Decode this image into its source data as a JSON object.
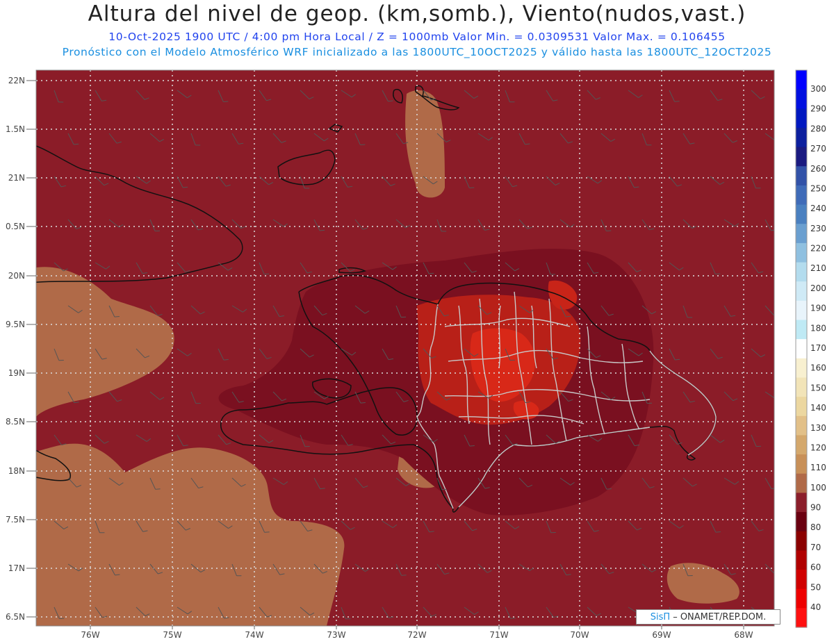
{
  "header": {
    "title": "Altura del nivel de geop. (km,somb.), Viento(nudos,vast.)",
    "line1": "10-Oct-2025  1900 UTC / 4:00 pm Hora Local / Z = 1000mb  Valor Min. = 0.0309531  Valor Max. = 0.106455",
    "line2": "Pronóstico con el Modelo Atmosférico WRF inicializado a las 1800UTC_10OCT2025 y válido hasta las  1800UTC_12OCT2025"
  },
  "axes": {
    "lat_labels": [
      "22N",
      "1.5N",
      "21N",
      "0.5N",
      "20N",
      "9.5N",
      "19N",
      "8.5N",
      "18N",
      "7.5N",
      "17N",
      "6.5N"
    ],
    "lon_labels": [
      "76W",
      "75W",
      "74W",
      "73W",
      "72W",
      "71W",
      "70W",
      "69W",
      "68W"
    ]
  },
  "colorbar": {
    "labels": [
      "300",
      "290",
      "280",
      "270",
      "260",
      "250",
      "240",
      "230",
      "220",
      "210",
      "200",
      "190",
      "180",
      "170",
      "160",
      "150",
      "140",
      "130",
      "120",
      "110",
      "100",
      "90",
      "80",
      "70",
      "60",
      "50",
      "40"
    ],
    "colors": [
      "#0000ff",
      "#0010e0",
      "#0018c0",
      "#0c1f9e",
      "#1a1a80",
      "#3252a8",
      "#3f6bb8",
      "#4a80c0",
      "#6a9fd0",
      "#8fc0e0",
      "#b3dcee",
      "#cfeaf6",
      "#e8f4fb",
      "#bfeaf5",
      "#ffffff",
      "#f8f0d0",
      "#f2e4b8",
      "#ecd7a0",
      "#e2c088",
      "#d4a86c",
      "#c89058",
      "#b06a48",
      "#8b1e2b",
      "#6a0010",
      "#8a0000",
      "#b00000",
      "#d00000",
      "#ee0000",
      "#ff1010"
    ]
  },
  "palette": {
    "background": "#8b1c28",
    "low_region": "#b06a48",
    "mid_region": "#7a1020",
    "high_region": "#b82018",
    "peak_region": "#d82818",
    "coast": "#111111",
    "border": "#c8c8c8",
    "grid": "#dddddd"
  },
  "credit": {
    "brand": "SisΠ",
    "org": "– ONAMET/REP.DOM."
  }
}
